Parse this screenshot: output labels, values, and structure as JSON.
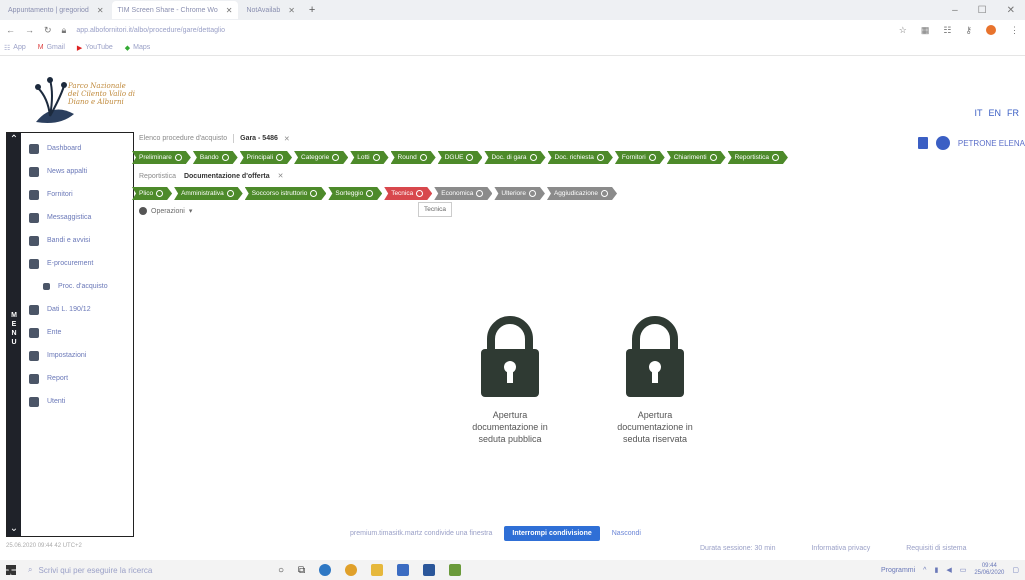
{
  "browser": {
    "tabs": [
      {
        "label": "Appuntamento | gregoriod",
        "active": false
      },
      {
        "label": "TIM Screen Share - Chrome Wo",
        "active": true
      },
      {
        "label": "NotAvailab",
        "active": false
      }
    ],
    "url": "app.albofornitori.it/albo/procedure/gare/dettaglio",
    "bookmarks": [
      "App",
      "Gmail",
      "YouTube",
      "Maps"
    ]
  },
  "org": {
    "logo_text": "Parco Nazionale del Cilento Vallo di Diano e Alburni"
  },
  "header": {
    "user_name": "PETRONE ELENA",
    "languages": [
      "IT",
      "EN",
      "FR"
    ]
  },
  "sidebar": {
    "menu_label": "MENU",
    "items": [
      {
        "label": "Dashboard",
        "icon": "home-icon"
      },
      {
        "label": "News appalti",
        "icon": "news-icon"
      },
      {
        "label": "Fornitori",
        "icon": "truck-icon"
      },
      {
        "label": "Messaggistica",
        "icon": "at-icon"
      },
      {
        "label": "Bandi e avvisi",
        "icon": "megaphone-icon"
      },
      {
        "label": "E-procurement",
        "icon": "cart-icon"
      },
      {
        "label": "Proc. d'acquisto",
        "icon": "list-icon",
        "sub": true
      },
      {
        "label": "Dati L. 190/12",
        "icon": "arrow-icon"
      },
      {
        "label": "Ente",
        "icon": "people-icon"
      },
      {
        "label": "Impostazioni",
        "icon": "gear-icon"
      },
      {
        "label": "Report",
        "icon": "chart-icon"
      },
      {
        "label": "Utenti",
        "icon": "user-icon"
      }
    ]
  },
  "breadcrumb1": {
    "prefix": "Elenco procedure d'acquisto",
    "current": "Gara - 5486"
  },
  "steps1": [
    "Preliminare",
    "Bando",
    "Principali",
    "Categorie",
    "Lotti",
    "Round",
    "DGUE",
    "Doc. di gara",
    "Doc. richiesta",
    "Fornitori",
    "Chiarimenti",
    "Reportistica"
  ],
  "breadcrumb2": {
    "prefix": "Reportistica",
    "current": "Documentazione d'offerta"
  },
  "steps2": [
    {
      "label": "Plico",
      "status": "done"
    },
    {
      "label": "Amministrativa",
      "status": "done"
    },
    {
      "label": "Soccorso istruttorio",
      "status": "done"
    },
    {
      "label": "Sorteggio",
      "status": "done"
    },
    {
      "label": "Tecnica",
      "status": "active"
    },
    {
      "label": "Economica",
      "status": "todo"
    },
    {
      "label": "Ulteriore",
      "status": "todo"
    },
    {
      "label": "Aggiudicazione",
      "status": "todo"
    }
  ],
  "operations_label": "Operazioni",
  "tooltip": "Tecnica",
  "locks": [
    {
      "label_l1": "Apertura",
      "label_l2": "documentazione in",
      "label_l3": "seduta pubblica"
    },
    {
      "label_l1": "Apertura",
      "label_l2": "documentazione in",
      "label_l3": "seduta riservata"
    }
  ],
  "share": {
    "message": "premium.timasitk.martz condivide una finestra",
    "stop_label": "Interrompi condivisione",
    "hide_label": "Nascondi"
  },
  "footer": {
    "timestamp": "25.06.2020 09:44 42 UTC+2",
    "session": "Durata sessione: 30 min",
    "privacy": "Informativa privacy",
    "requirements": "Requisiti di sistema"
  },
  "taskbar": {
    "search_placeholder": "Scrivi qui per eseguire la ricerca",
    "programs": "Programmi",
    "time": "09:44",
    "date": "25/06/2020"
  },
  "colors": {
    "step_green": "#4d8a2a",
    "step_red": "#d8484d",
    "step_gray": "#8b8b8b",
    "accent_blue": "#2f6fd6",
    "lock_dark": "#2f3a33"
  }
}
